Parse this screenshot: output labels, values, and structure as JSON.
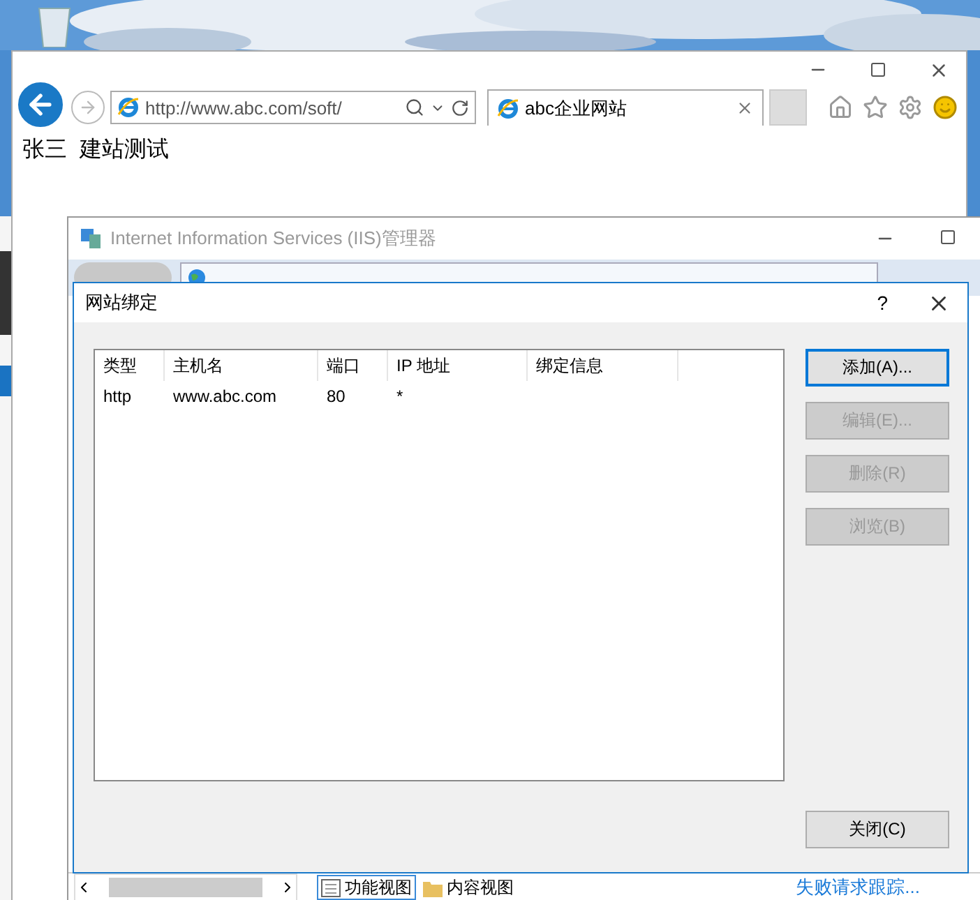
{
  "browser": {
    "address": "http://www.abc.com/soft/",
    "tab_title": "abc企业网站",
    "page_text": "张三  建站测试"
  },
  "iis_window": {
    "title": "Internet Information Services (IIS)管理器",
    "view_tabs": [
      {
        "label": "功能视图",
        "selected": true
      },
      {
        "label": "内容视图",
        "selected": false
      }
    ],
    "action_link": "失败请求跟踪..."
  },
  "dialog": {
    "title": "网站绑定",
    "help": "?",
    "columns": [
      "类型",
      "主机名",
      "端口",
      "IP 地址",
      "绑定信息"
    ],
    "rows": [
      [
        "http",
        "www.abc.com",
        "80",
        "*"
      ]
    ],
    "buttons": [
      {
        "label": "添加(A)...",
        "disabled": false,
        "focused": true
      },
      {
        "label": "编辑(E)...",
        "disabled": true,
        "focused": false
      },
      {
        "label": "删除(R)",
        "disabled": true,
        "focused": false
      },
      {
        "label": "浏览(B)",
        "disabled": true,
        "focused": false
      }
    ],
    "close_button": "关闭(C)"
  }
}
